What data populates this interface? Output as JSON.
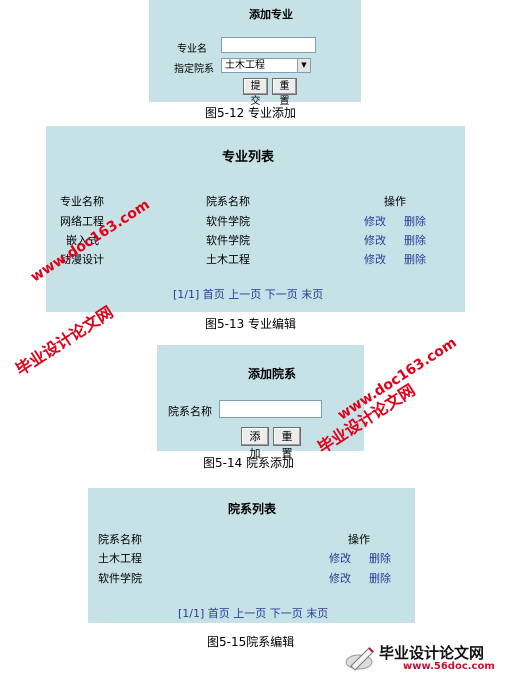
{
  "fig12": {
    "title": "添加专业",
    "name_label": "专业名",
    "name_value": "",
    "dept_label": "指定院系",
    "dept_selected": "土木工程",
    "submit_label": "提交",
    "reset_label": "重置",
    "caption": "图5-12 专业添加"
  },
  "fig13": {
    "title": "专业列表",
    "headers": [
      "专业名称",
      "院系名称",
      "操作"
    ],
    "rows": [
      {
        "name": "网络工程",
        "dept": "软件学院",
        "edit": "修改",
        "del": "删除"
      },
      {
        "name": "嵌入式",
        "dept": "软件学院",
        "edit": "修改",
        "del": "删除"
      },
      {
        "name": "动漫设计",
        "dept": "土木工程",
        "edit": "修改",
        "del": "删除"
      }
    ],
    "pager": {
      "info": "[1/1]",
      "first": "首页",
      "prev": "上一页",
      "next": "下一页",
      "last": "末页"
    },
    "caption": "图5-13 专业编辑"
  },
  "fig14": {
    "title": "添加院系",
    "name_label": "院系名称",
    "name_value": "",
    "add_label": "添加",
    "reset_label": "重置",
    "caption": "图5-14 院系添加"
  },
  "fig15": {
    "title": "院系列表",
    "headers": [
      "院系名称",
      "操作"
    ],
    "rows": [
      {
        "name": "土木工程",
        "edit": "修改",
        "del": "删除"
      },
      {
        "name": "软件学院",
        "edit": "修改",
        "del": "删除"
      }
    ],
    "pager": {
      "info": "[1/1]",
      "first": "首页",
      "prev": "上一页",
      "next": "下一页",
      "last": "末页"
    },
    "caption": "图5-15院系编辑"
  },
  "watermarks": {
    "site_cn": "毕业设计论文网",
    "site_url": "www.doc163.com",
    "logo_text": "毕业设计论文网",
    "logo_url": "www.56doc.com"
  },
  "colors": {
    "panel_bg": "#c7e2e6",
    "link": "#2a3a9a",
    "watermark": "#e0001a"
  }
}
